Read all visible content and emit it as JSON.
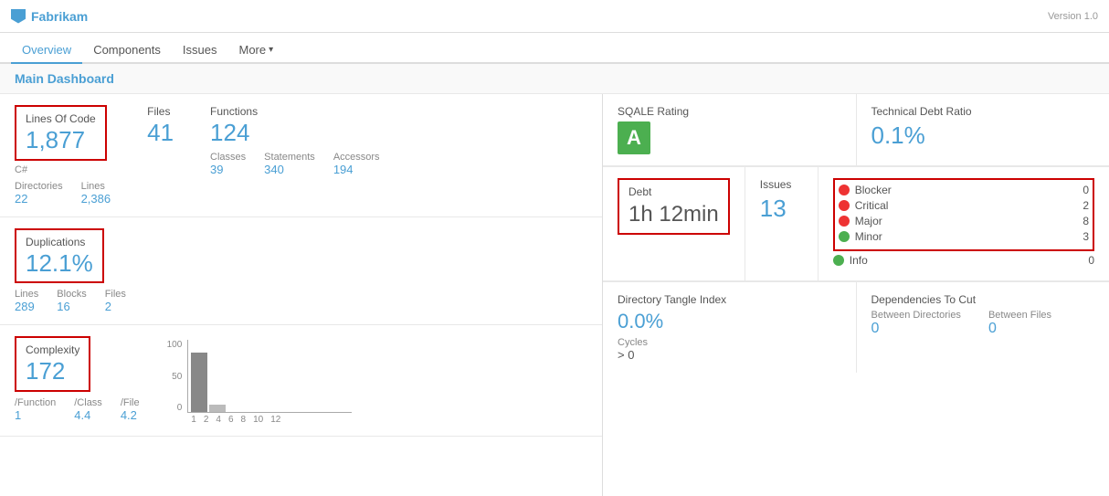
{
  "header": {
    "logo": "Fabrikam",
    "version": "Version 1.0"
  },
  "nav": {
    "items": [
      {
        "label": "Overview",
        "active": true
      },
      {
        "label": "Components",
        "active": false
      },
      {
        "label": "Issues",
        "active": false
      },
      {
        "label": "More",
        "active": false
      }
    ]
  },
  "page": {
    "title": "Main Dashboard"
  },
  "left": {
    "lines_of_code": {
      "label": "Lines Of Code",
      "value": "1,877",
      "sublabel": "C#",
      "directories_label": "Directories",
      "directories_value": "22",
      "lines_label": "Lines",
      "lines_value": "2,386",
      "files_label": "Files",
      "files_value": "41",
      "functions_label": "Functions",
      "functions_value": "124",
      "classes_label": "Classes",
      "classes_value": "39",
      "statements_label": "Statements",
      "statements_value": "340",
      "accessors_label": "Accessors",
      "accessors_value": "194"
    },
    "duplications": {
      "label": "Duplications",
      "value": "12.1%",
      "lines_label": "Lines",
      "lines_value": "289",
      "blocks_label": "Blocks",
      "blocks_value": "16",
      "files_label": "Files",
      "files_value": "2"
    },
    "complexity": {
      "label": "Complexity",
      "value": "172",
      "function_label": "/Function",
      "function_value": "1",
      "class_label": "/Class",
      "class_value": "4.4",
      "file_label": "/File",
      "file_value": "4.2",
      "chart_y_max": "100",
      "chart_y_mid": "50",
      "chart_y_min": "0",
      "chart_x_labels": [
        "1",
        "2",
        "4",
        "6",
        "8",
        "10",
        "12"
      ]
    }
  },
  "right": {
    "sqale": {
      "label": "SQALE Rating",
      "value": "A"
    },
    "tech_debt": {
      "label": "Technical Debt Ratio",
      "value": "0.1%"
    },
    "debt": {
      "label": "Debt",
      "value": "1h 12min"
    },
    "issues": {
      "label": "Issues",
      "value": "13",
      "items": [
        {
          "type": "Blocker",
          "count": "0",
          "color": "blocker"
        },
        {
          "type": "Critical",
          "count": "2",
          "color": "critical"
        },
        {
          "type": "Major",
          "count": "8",
          "color": "major"
        },
        {
          "type": "Minor",
          "count": "3",
          "color": "minor"
        },
        {
          "type": "Info",
          "count": "0",
          "color": "info"
        }
      ]
    },
    "tangle": {
      "label": "Directory Tangle Index",
      "value": "0.0%",
      "cycles_label": "Cycles",
      "cycles_value": "> 0"
    },
    "deps": {
      "label": "Dependencies To Cut",
      "between_directories_label": "Between Directories",
      "between_directories_value": "0",
      "between_files_label": "Between Files",
      "between_files_value": "0"
    }
  }
}
